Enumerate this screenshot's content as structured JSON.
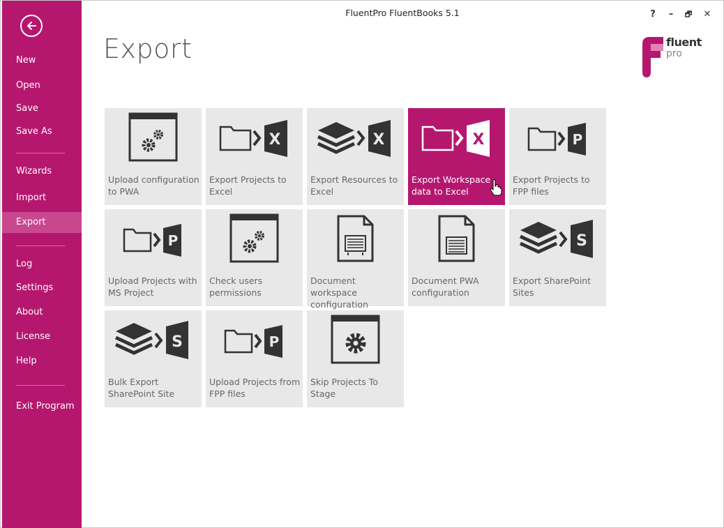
{
  "window": {
    "title": "FluentPro FluentBooks 5.1",
    "controls": {
      "help": "?",
      "minimize": "–",
      "restore": "🗗",
      "close": "✕"
    }
  },
  "sidebar": {
    "items": [
      {
        "label": "New"
      },
      {
        "label": "Open"
      },
      {
        "label": "Save"
      },
      {
        "label": "Save As"
      },
      {
        "label": "Wizards"
      },
      {
        "label": "Import"
      },
      {
        "label": "Export",
        "active": true
      },
      {
        "label": "Log"
      },
      {
        "label": "Settings"
      },
      {
        "label": "About"
      },
      {
        "label": "License"
      },
      {
        "label": "Help"
      },
      {
        "label": "Exit Program"
      }
    ]
  },
  "page": {
    "title": "Export"
  },
  "logo": {
    "line1": "fluent",
    "line2": "pro"
  },
  "tiles": [
    {
      "label": "Upload configuration to PWA",
      "icon": "config-window-icon"
    },
    {
      "label": "Export Projects to Excel",
      "icon": "folder-to-excel-icon"
    },
    {
      "label": "Export Resources to Excel",
      "icon": "layers-to-excel-icon"
    },
    {
      "label": "Export Workspace data to Excel",
      "icon": "folder-to-excel-icon",
      "active": true
    },
    {
      "label": "Export Projects to FPP files",
      "icon": "folder-to-project-icon"
    },
    {
      "label": "Upload Projects with MS Project",
      "icon": "folder-to-project-icon"
    },
    {
      "label": "Check users permissions",
      "icon": "config-window-icon"
    },
    {
      "label": "Document workspace configuration",
      "icon": "document-icon"
    },
    {
      "label": "Document PWA configuration",
      "icon": "document-icon"
    },
    {
      "label": "Export SharePoint Sites",
      "icon": "layers-to-sharepoint-icon"
    },
    {
      "label": "Bulk Export SharePoint Site",
      "icon": "layers-to-sharepoint-icon"
    },
    {
      "label": "Upload Projects from FPP files",
      "icon": "folder-to-project-icon"
    },
    {
      "label": "Skip Projects To Stage",
      "icon": "gear-window-icon"
    }
  ],
  "colors": {
    "accent": "#b5176f",
    "tile": "#e8e8e8",
    "icon": "#333333"
  }
}
